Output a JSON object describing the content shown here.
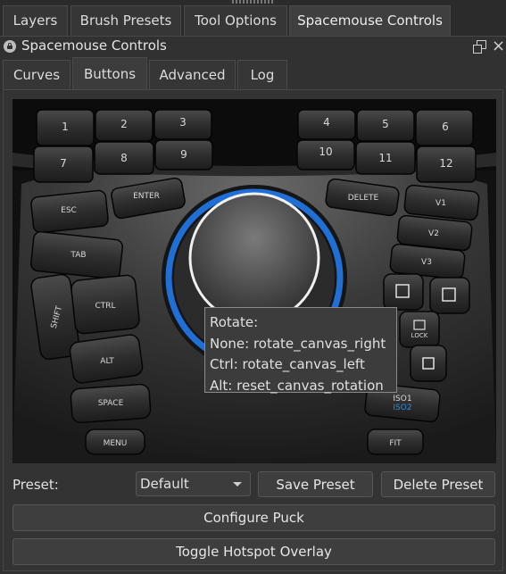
{
  "dock_tabs": [
    "Layers",
    "Brush Presets",
    "Tool Options",
    "Spacemouse Controls"
  ],
  "docker": {
    "title": "Spacemouse Controls",
    "float_icon": "float-window-icon",
    "close_icon": "×"
  },
  "inner_tabs": [
    "Curves",
    "Buttons",
    "Advanced",
    "Log"
  ],
  "device": {
    "keys_left_top": [
      "1",
      "2",
      "3",
      "7",
      "8",
      "9"
    ],
    "keys_right_top": [
      "4",
      "5",
      "6",
      "10",
      "11",
      "12"
    ],
    "keys_left": [
      "ESC",
      "ENTER",
      "TAB",
      "SHIFT",
      "CTRL",
      "ALT",
      "SPACE",
      "MENU"
    ],
    "keys_right": [
      "DELETE",
      "V1",
      "V2",
      "V3",
      "LOCK",
      "ISO1",
      "ISO2",
      "FIT"
    ],
    "accent_blue": "#2d8ee0"
  },
  "tooltip": {
    "title": "Rotate:",
    "none": "None: rotate_canvas_right",
    "ctrl": "Ctrl: rotate_canvas_left",
    "alt": "Alt: reset_canvas_rotation"
  },
  "preset": {
    "label": "Preset:",
    "selected": "Default",
    "save": "Save Preset",
    "delete": "Delete Preset"
  },
  "actions": {
    "configure_puck": "Configure Puck",
    "toggle_hotspot": "Toggle Hotspot Overlay"
  },
  "colors": {
    "background": "#313131",
    "tab_active": "#3f3f3f",
    "border": "#4a4a4a"
  }
}
